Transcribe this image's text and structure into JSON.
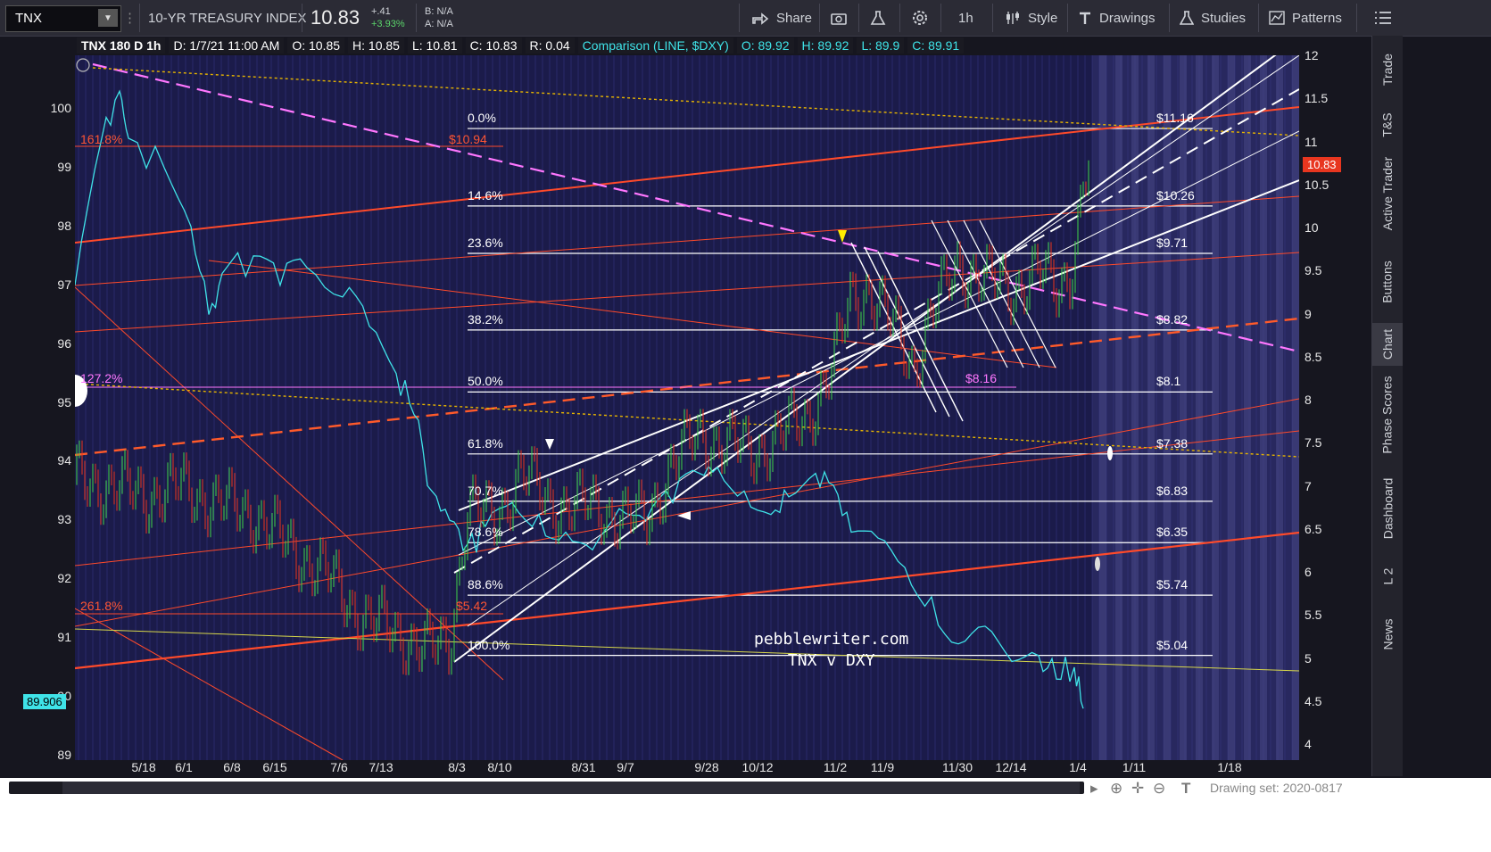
{
  "toolbar": {
    "symbol": "TNX",
    "title": "10-YR TREASURY INDEX",
    "last": "10.83",
    "change": "+.41",
    "change_pct": "+3.93%",
    "bid": "B: N/A",
    "ask": "A: N/A",
    "share": "Share",
    "interval": "1h",
    "style": "Style",
    "drawings": "Drawings",
    "studies": "Studies",
    "patterns": "Patterns"
  },
  "infobar": {
    "study": "TNX 180 D 1h",
    "date": "D: 1/7/21 11:00 AM",
    "open": "O: 10.85",
    "high": "H: 10.85",
    "low": "L: 10.81",
    "close": "C: 10.83",
    "range": "R: 0.04",
    "comparison": "Comparison (LINE, $DXY)",
    "c_open": "O: 89.92",
    "c_high": "H: 89.92",
    "c_low": "L: 89.9",
    "c_close": "C: 89.91"
  },
  "left_axis": [
    "100",
    "99",
    "98",
    "97",
    "96",
    "95",
    "94",
    "93",
    "92",
    "91",
    "90",
    "89"
  ],
  "right_axis": [
    "12",
    "11.5",
    "11",
    "10.5",
    "10",
    "9.5",
    "9",
    "8.5",
    "8",
    "7.5",
    "7",
    "6.5",
    "6",
    "5.5",
    "5",
    "4.5",
    "4"
  ],
  "x_axis": [
    "5/18",
    "6/1",
    "6/8",
    "6/15",
    "7/6",
    "7/13",
    "8/3",
    "8/10",
    "8/31",
    "9/7",
    "9/28",
    "10/12",
    "11/2",
    "11/9",
    "11/30",
    "12/14",
    "1/4",
    "1/11",
    "1/18"
  ],
  "price_flag": "10.83",
  "compare_flag": "89.906",
  "fib_levels": [
    {
      "pct": "0.0%",
      "price": "$11.16"
    },
    {
      "pct": "14.6%",
      "price": "$10.26"
    },
    {
      "pct": "23.6%",
      "price": "$9.71"
    },
    {
      "pct": "38.2%",
      "price": "$8.82"
    },
    {
      "pct": "50.0%",
      "price": "$8.1"
    },
    {
      "pct": "61.8%",
      "price": "$7.38"
    },
    {
      "pct": "70.7%",
      "price": "$6.83"
    },
    {
      "pct": "78.6%",
      "price": "$6.35"
    },
    {
      "pct": "88.6%",
      "price": "$5.74"
    },
    {
      "pct": "100.0%",
      "price": "$5.04"
    }
  ],
  "red_labels": {
    "ext161": "161.8%",
    "price1094": "$10.94",
    "ext261": "261.8%",
    "price542": "$5.42"
  },
  "magenta_labels": {
    "ext127": "127.2%",
    "price816": "$8.16"
  },
  "watermark": {
    "line1": "pebblewriter.com",
    "line2": "TNX v DXY"
  },
  "side_tabs": [
    "Trade",
    "T&S",
    "Active Trader",
    "Buttons",
    "Chart",
    "Phase Scores",
    "Dashboard",
    "L 2",
    "News"
  ],
  "drawing_set": "Drawing set: 2020-0817",
  "colors": {
    "plot_bg": "#1b1b4a",
    "candle_up": "#3fd64a",
    "candle_down": "#e8361f",
    "compare_line": "#3fe3e8",
    "trend_red": "#ff4a2a",
    "magenta": "#ff77ff",
    "fib_white": "#ffffff"
  }
}
